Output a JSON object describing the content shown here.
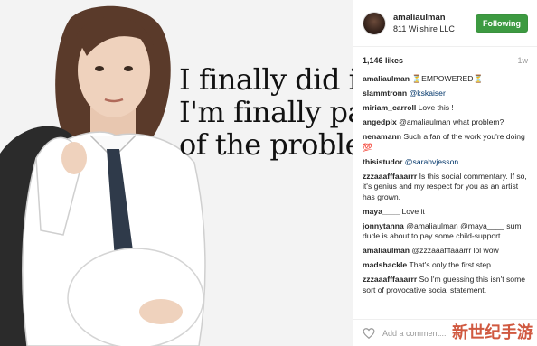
{
  "post": {
    "image_caption_lines": [
      "I finally did it.",
      "I'm finally part",
      "of the problem."
    ]
  },
  "header": {
    "username": "amaliaulman",
    "location": "811 Wilshire LLC",
    "follow_label": "Following"
  },
  "stats": {
    "likes": "1,146 likes",
    "age": "1w"
  },
  "comments": [
    {
      "user": "amaliaulman",
      "text": "⏳EMPOWERED⏳"
    },
    {
      "user": "slammtronn",
      "text": "@kskaiser"
    },
    {
      "user": "miriam_carroll",
      "text": "Love this !"
    },
    {
      "user": "angedpix",
      "text": "@amaliaulman what problem?"
    },
    {
      "user": "nenamann",
      "text": "Such a fan of the work you're doing 💯"
    },
    {
      "user": "thisistudor",
      "text": "@sarahvjesson"
    },
    {
      "user": "zzzaaafffaaarrr",
      "text": "Is this social commentary. If so, it's genius and my respect for you as an artist has grown."
    },
    {
      "user": "maya____",
      "text": "Love it"
    },
    {
      "user": "jonnytanna",
      "text": "@amaliaulman @maya____ sum dude is about to pay some child-support"
    },
    {
      "user": "amaliaulman",
      "text": "@zzzaaafffaaarrr lol wow"
    },
    {
      "user": "madshackle",
      "text": "That's only the first step"
    },
    {
      "user": "zzzaaafffaaarrr",
      "text": "So I'm guessing this isn't some sort of provocative social statement."
    }
  ],
  "footer": {
    "add_comment_placeholder": "Add a comment..."
  },
  "watermark": "新世纪手游",
  "colors": {
    "follow_button": "#3d9a41",
    "mention": "#003569"
  }
}
